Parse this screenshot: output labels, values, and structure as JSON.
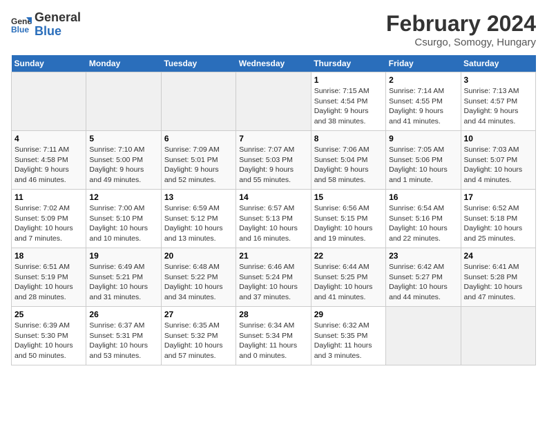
{
  "header": {
    "logo_line1": "General",
    "logo_line2": "Blue",
    "main_title": "February 2024",
    "subtitle": "Csurgo, Somogy, Hungary"
  },
  "days_of_week": [
    "Sunday",
    "Monday",
    "Tuesday",
    "Wednesday",
    "Thursday",
    "Friday",
    "Saturday"
  ],
  "weeks": [
    [
      {
        "day": "",
        "info": ""
      },
      {
        "day": "",
        "info": ""
      },
      {
        "day": "",
        "info": ""
      },
      {
        "day": "",
        "info": ""
      },
      {
        "day": "1",
        "info": "Sunrise: 7:15 AM\nSunset: 4:54 PM\nDaylight: 9 hours\nand 38 minutes."
      },
      {
        "day": "2",
        "info": "Sunrise: 7:14 AM\nSunset: 4:55 PM\nDaylight: 9 hours\nand 41 minutes."
      },
      {
        "day": "3",
        "info": "Sunrise: 7:13 AM\nSunset: 4:57 PM\nDaylight: 9 hours\nand 44 minutes."
      }
    ],
    [
      {
        "day": "4",
        "info": "Sunrise: 7:11 AM\nSunset: 4:58 PM\nDaylight: 9 hours\nand 46 minutes."
      },
      {
        "day": "5",
        "info": "Sunrise: 7:10 AM\nSunset: 5:00 PM\nDaylight: 9 hours\nand 49 minutes."
      },
      {
        "day": "6",
        "info": "Sunrise: 7:09 AM\nSunset: 5:01 PM\nDaylight: 9 hours\nand 52 minutes."
      },
      {
        "day": "7",
        "info": "Sunrise: 7:07 AM\nSunset: 5:03 PM\nDaylight: 9 hours\nand 55 minutes."
      },
      {
        "day": "8",
        "info": "Sunrise: 7:06 AM\nSunset: 5:04 PM\nDaylight: 9 hours\nand 58 minutes."
      },
      {
        "day": "9",
        "info": "Sunrise: 7:05 AM\nSunset: 5:06 PM\nDaylight: 10 hours\nand 1 minute."
      },
      {
        "day": "10",
        "info": "Sunrise: 7:03 AM\nSunset: 5:07 PM\nDaylight: 10 hours\nand 4 minutes."
      }
    ],
    [
      {
        "day": "11",
        "info": "Sunrise: 7:02 AM\nSunset: 5:09 PM\nDaylight: 10 hours\nand 7 minutes."
      },
      {
        "day": "12",
        "info": "Sunrise: 7:00 AM\nSunset: 5:10 PM\nDaylight: 10 hours\nand 10 minutes."
      },
      {
        "day": "13",
        "info": "Sunrise: 6:59 AM\nSunset: 5:12 PM\nDaylight: 10 hours\nand 13 minutes."
      },
      {
        "day": "14",
        "info": "Sunrise: 6:57 AM\nSunset: 5:13 PM\nDaylight: 10 hours\nand 16 minutes."
      },
      {
        "day": "15",
        "info": "Sunrise: 6:56 AM\nSunset: 5:15 PM\nDaylight: 10 hours\nand 19 minutes."
      },
      {
        "day": "16",
        "info": "Sunrise: 6:54 AM\nSunset: 5:16 PM\nDaylight: 10 hours\nand 22 minutes."
      },
      {
        "day": "17",
        "info": "Sunrise: 6:52 AM\nSunset: 5:18 PM\nDaylight: 10 hours\nand 25 minutes."
      }
    ],
    [
      {
        "day": "18",
        "info": "Sunrise: 6:51 AM\nSunset: 5:19 PM\nDaylight: 10 hours\nand 28 minutes."
      },
      {
        "day": "19",
        "info": "Sunrise: 6:49 AM\nSunset: 5:21 PM\nDaylight: 10 hours\nand 31 minutes."
      },
      {
        "day": "20",
        "info": "Sunrise: 6:48 AM\nSunset: 5:22 PM\nDaylight: 10 hours\nand 34 minutes."
      },
      {
        "day": "21",
        "info": "Sunrise: 6:46 AM\nSunset: 5:24 PM\nDaylight: 10 hours\nand 37 minutes."
      },
      {
        "day": "22",
        "info": "Sunrise: 6:44 AM\nSunset: 5:25 PM\nDaylight: 10 hours\nand 41 minutes."
      },
      {
        "day": "23",
        "info": "Sunrise: 6:42 AM\nSunset: 5:27 PM\nDaylight: 10 hours\nand 44 minutes."
      },
      {
        "day": "24",
        "info": "Sunrise: 6:41 AM\nSunset: 5:28 PM\nDaylight: 10 hours\nand 47 minutes."
      }
    ],
    [
      {
        "day": "25",
        "info": "Sunrise: 6:39 AM\nSunset: 5:30 PM\nDaylight: 10 hours\nand 50 minutes."
      },
      {
        "day": "26",
        "info": "Sunrise: 6:37 AM\nSunset: 5:31 PM\nDaylight: 10 hours\nand 53 minutes."
      },
      {
        "day": "27",
        "info": "Sunrise: 6:35 AM\nSunset: 5:32 PM\nDaylight: 10 hours\nand 57 minutes."
      },
      {
        "day": "28",
        "info": "Sunrise: 6:34 AM\nSunset: 5:34 PM\nDaylight: 11 hours\nand 0 minutes."
      },
      {
        "day": "29",
        "info": "Sunrise: 6:32 AM\nSunset: 5:35 PM\nDaylight: 11 hours\nand 3 minutes."
      },
      {
        "day": "",
        "info": ""
      },
      {
        "day": "",
        "info": ""
      }
    ]
  ]
}
